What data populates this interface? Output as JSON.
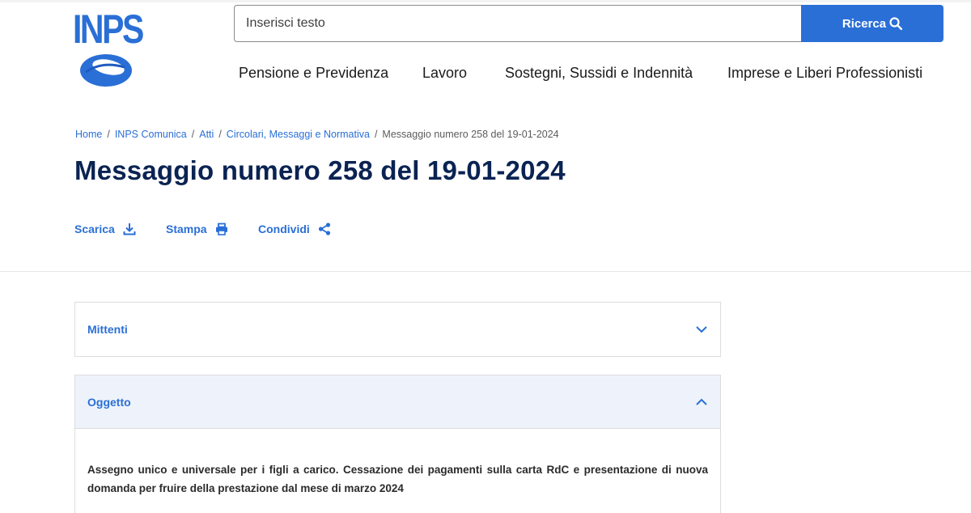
{
  "brand": {
    "logo_text": "INPS",
    "accent": "#2a6fd6",
    "title_color": "#0a2352"
  },
  "search": {
    "placeholder": "Inserisci testo",
    "button_label": "Ricerca",
    "button_icon": "search-icon"
  },
  "nav": {
    "items": [
      {
        "label": "Pensione e Previdenza"
      },
      {
        "label": "Lavoro"
      },
      {
        "label": "Sostegni, Sussidi e Indennità"
      },
      {
        "label": "Imprese e Liberi Professionisti"
      }
    ]
  },
  "breadcrumb": {
    "items": [
      {
        "label": "Home"
      },
      {
        "label": "INPS Comunica"
      },
      {
        "label": "Atti"
      },
      {
        "label": "Circolari, Messaggi e Normativa"
      }
    ],
    "current": "Messaggio numero 258 del 19-01-2024",
    "separator": "/"
  },
  "page": {
    "title": "Messaggio numero 258 del 19-01-2024"
  },
  "actions": [
    {
      "label": "Scarica",
      "icon": "download-icon"
    },
    {
      "label": "Stampa",
      "icon": "print-icon"
    },
    {
      "label": "Condividi",
      "icon": "share-icon"
    }
  ],
  "accordions": [
    {
      "title": "Mittenti",
      "expanded": false,
      "icon": "chevron-down-icon"
    },
    {
      "title": "Oggetto",
      "expanded": true,
      "icon": "chevron-up-icon",
      "body": "Assegno unico e universale per i figli a carico. Cessazione dei pagamenti sulla carta RdC e presentazione di nuova domanda per fruire della prestazione dal mese di marzo 2024"
    }
  ]
}
